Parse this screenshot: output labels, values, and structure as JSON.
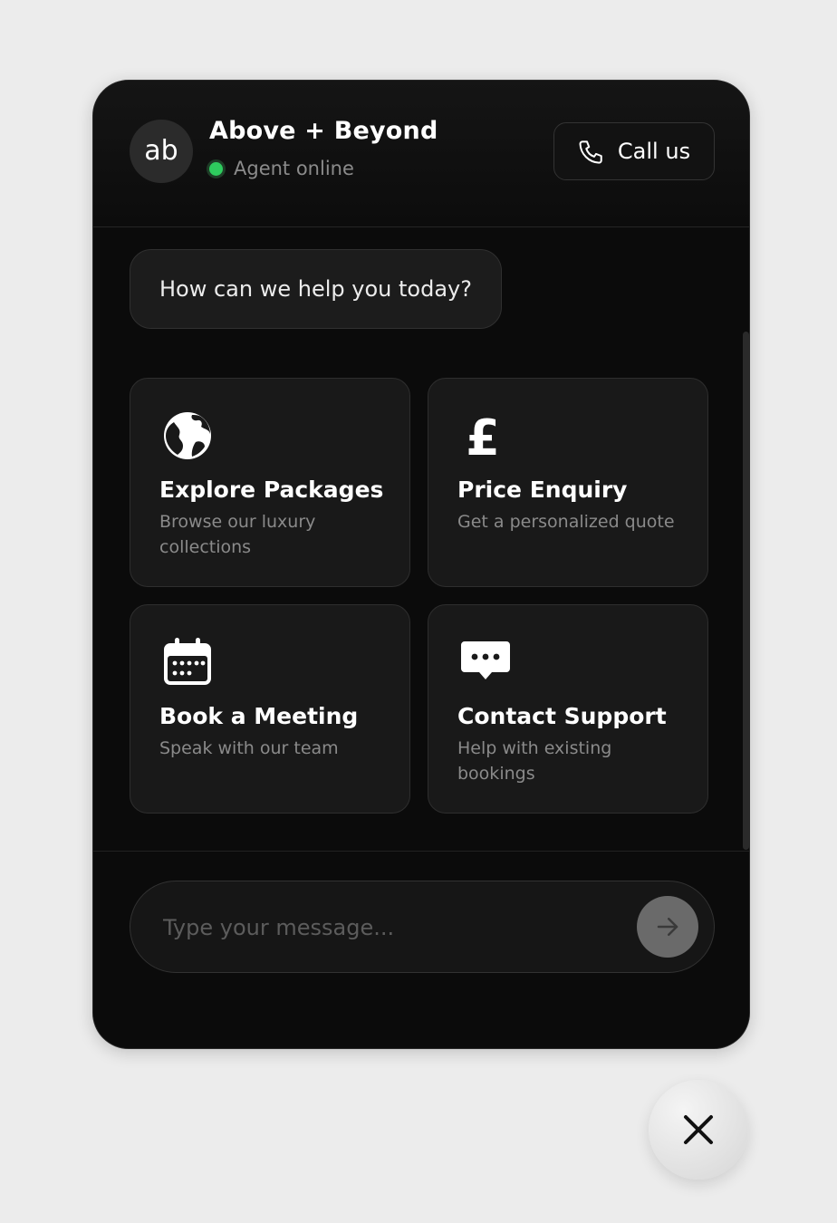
{
  "header": {
    "logo_text": "ab",
    "brand_name": "Above + Beyond",
    "status": "Agent online",
    "call_label": "Call us"
  },
  "chat": {
    "greeting": "How can we help you today?"
  },
  "options": [
    {
      "title": "Explore Packages",
      "description": "Browse our luxury collections",
      "icon": "globe-icon"
    },
    {
      "title": "Price Enquiry",
      "description": "Get a personalized quote",
      "icon": "pound-icon"
    },
    {
      "title": "Book a Meeting",
      "description": "Speak with our team",
      "icon": "calendar-icon"
    },
    {
      "title": "Contact Support",
      "description": "Help with existing bookings",
      "icon": "chat-bubble-icon"
    }
  ],
  "composer": {
    "placeholder": "Type your message...",
    "value": ""
  },
  "colors": {
    "panel_bg": "#0b0b0b",
    "card_bg": "#191919",
    "status_green": "#2ecc5e",
    "send_button": "#6a6a6a",
    "page_bg": "#ececec"
  }
}
